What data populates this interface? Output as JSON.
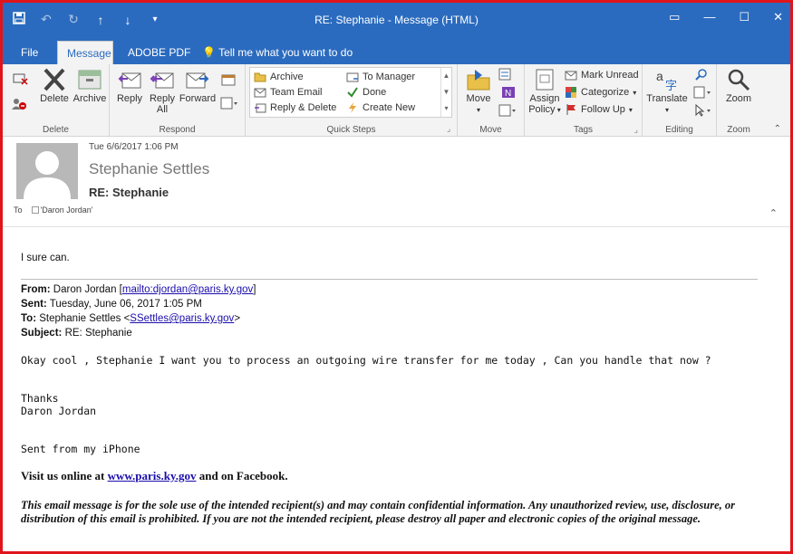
{
  "window": {
    "title": "RE: Stephanie  -  Message (HTML)",
    "controls": [
      "restore-ribbon",
      "minimize",
      "maximize",
      "close"
    ]
  },
  "qat": {
    "icons": [
      "save-icon",
      "undo-icon",
      "redo-icon",
      "up-icon",
      "down-icon",
      "customize-icon"
    ]
  },
  "tabs": [
    "File",
    "Message",
    "ADOBE PDF",
    "Tell me what you want to do"
  ],
  "ribbon": {
    "delete_group": {
      "label": "Delete",
      "delete": "Delete",
      "archive": "Archive"
    },
    "respond_group": {
      "label": "Respond",
      "reply": "Reply",
      "reply_all_1": "Reply",
      "reply_all_2": "All",
      "forward": "Forward"
    },
    "quick_steps": {
      "label": "Quick Steps",
      "items": [
        "Archive",
        "Team Email",
        "Reply & Delete",
        "To Manager",
        "Done",
        "Create New"
      ]
    },
    "move_group": {
      "label": "Move",
      "move": "Move"
    },
    "tags_group": {
      "label": "Tags",
      "assign_1": "Assign",
      "assign_2": "Policy",
      "mark_unread": "Mark Unread",
      "categorize": "Categorize",
      "follow_up": "Follow Up"
    },
    "editing_group": {
      "label": "Editing",
      "translate": "Translate"
    },
    "zoom_group": {
      "label": "Zoom",
      "zoom": "Zoom"
    }
  },
  "message": {
    "date": "Tue 6/6/2017 1:06 PM",
    "sender": "Stephanie Settles",
    "subject": "RE: Stephanie",
    "to_label": "To",
    "to_value": "'Daron Jordan'"
  },
  "body": {
    "reply": "I sure can.",
    "from_label": "From:",
    "from_name": "Daron Jordan [",
    "from_link": "mailto:djordan@paris.ky.gov",
    "from_end": "]",
    "sent_label": "Sent:",
    "sent_value": "Tuesday, June 06, 2017 1:05 PM",
    "to_label": "To:",
    "to_name": "Stephanie Settles <",
    "to_link": "SSettles@paris.ky.gov",
    "to_end": ">",
    "subject_label": "Subject:",
    "subject_value": "RE: Stephanie",
    "line1": "Okay cool , Stephanie I want you to process an outgoing wire transfer for me today , Can you handle that now ?",
    "thanks": "Thanks",
    "signature": "Daron Jordan",
    "iphone": "Sent from my iPhone",
    "visit_pre": "Visit us online at ",
    "visit_link": "www.paris.ky.gov",
    "visit_post": " and on Facebook.",
    "disclaimer": "This email message is for the sole use of the intended recipient(s) and may contain confidential information. Any unauthorized review, use, disclosure, or distribution of this email is prohibited. If you are not the intended recipient, please destroy all paper and electronic copies of the original message."
  },
  "colors": {
    "accent": "#2b6bbf",
    "frame": "#e0151b",
    "ribbon_bg": "#f3f3f3"
  }
}
